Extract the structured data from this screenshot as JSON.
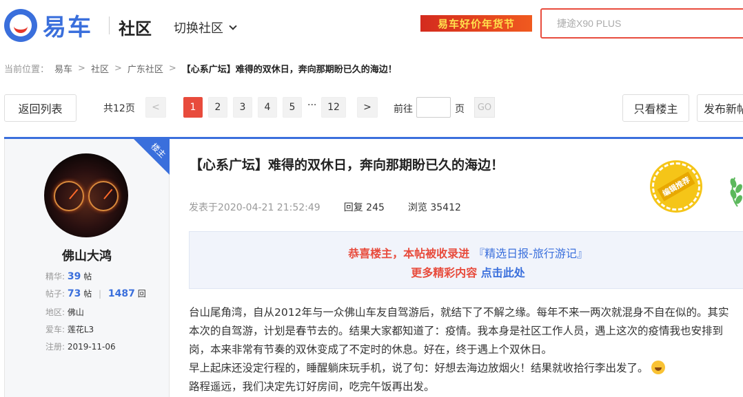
{
  "header": {
    "logo_text": "易车",
    "community_title": "社区",
    "switch_label": "切换社区",
    "promo_text": "易车好价年货节",
    "search_placeholder": "捷途X90 PLUS"
  },
  "breadcrumb": {
    "prefix": "当前位置：",
    "items": [
      "易车",
      "社区",
      "广东社区"
    ],
    "separator": ">",
    "current": "【心系广坛】难得的双休日，奔向那期盼已久的海边！"
  },
  "pagination": {
    "back_label": "返回列表",
    "total_label": "共12页",
    "prev_label": "<",
    "pages": [
      "1",
      "2",
      "3",
      "4",
      "5"
    ],
    "ellipsis": "···",
    "last_page": "12",
    "next_label": ">",
    "goto_label": "前往",
    "page_unit": "页",
    "go_label": "GO",
    "op_only_label": "只看楼主",
    "new_post_label": "发布新帖"
  },
  "author": {
    "ribbon": "楼主",
    "name": "佛山大鸿",
    "jinghua_label": "精华:",
    "jinghua_count": "39",
    "jinghua_unit": "帖",
    "posts_label": "帖子:",
    "posts_count": "73",
    "posts_unit": "帖",
    "divider": "|",
    "replies_count": "1487",
    "replies_unit": "回",
    "region_label": "地区:",
    "region": "佛山",
    "car_label": "爱车:",
    "car": "莲花L3",
    "register_label": "注册:",
    "register_date": "2019-11-06"
  },
  "post": {
    "title": "【心系广坛】难得的双休日，奔向那期盼已久的海边！",
    "posted_at": "发表于2020-04-21 21:52:49",
    "reply_label": "回复",
    "reply_count": "245",
    "view_label": "浏览",
    "view_count": "35412",
    "seal_text": "编辑推荐",
    "notice_line1": "恭喜楼主，本帖被收录进",
    "notice_link1": "『精选日报-旅行游记』",
    "notice_line2": "更多精彩内容",
    "notice_link2": "点击此处",
    "body_lines": [
      "台山尾角湾，自从2012年与一众佛山车友自驾游后，就结下了不解之缘。每年不来一两次就混身不自在似的。其实",
      "本次的自驾游，计划是春节去的。结果大家都知道了：疫情。我本身是社区工作人员，遇上这次的疫情我也安排到",
      "岗，本来非常有节奏的双休变成了不定时的休息。好在，终于遇上个双休日。",
      "早上起床还没定行程的，睡醒躺床玩手机，说了句：好想去海边放烟火！结果就收拾行李出发了。",
      "路程遥远，我们决定先订好房间，吃完午饭再出发。"
    ]
  },
  "colors": {
    "brand_blue": "#3a6fdc",
    "accent_red": "#e84b3c",
    "seal_yellow": "#f5c518"
  }
}
